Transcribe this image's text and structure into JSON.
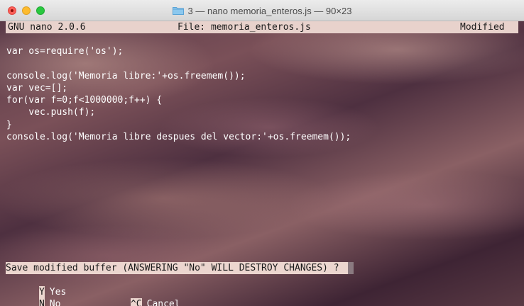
{
  "window": {
    "title": "3 — nano memoria_enteros.js — 90×23",
    "folder_icon": "folder-icon"
  },
  "nano": {
    "version": "GNU nano 2.0.6",
    "file": "File: memoria_enteros.js",
    "status": "Modified"
  },
  "code_lines": [
    "var os=require('os');",
    "",
    "console.log('Memoria libre:'+os.freemem());",
    "var vec=[];",
    "for(var f=0;f<1000000;f++) {",
    "    vec.push(f);",
    "}",
    "console.log('Memoria libre despues del vector:'+os.freemem());"
  ],
  "prompt": "Save modified buffer (ANSWERING \"No\" WILL DESTROY CHANGES) ?",
  "options": {
    "yes_key": "Y",
    "yes_label": "Yes",
    "no_key": "N",
    "no_label": "No",
    "cancel_key": "^C",
    "cancel_label": "Cancel"
  },
  "colors": {
    "close": "#fc5f57",
    "minimize": "#fdbb2e",
    "maximize": "#29c840",
    "highlight": "#ecd6cf"
  }
}
